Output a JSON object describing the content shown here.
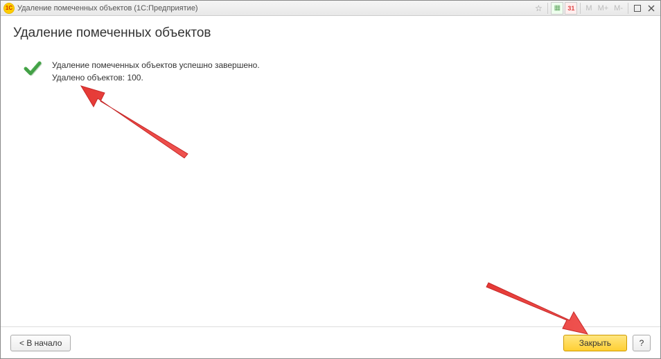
{
  "titlebar": {
    "app_icon_text": "1C",
    "title": "Удаление помеченных объектов  (1С:Предприятие)",
    "mem_buttons": [
      "M",
      "M+",
      "M-"
    ],
    "calendar_day": "31"
  },
  "page": {
    "title": "Удаление помеченных объектов"
  },
  "result": {
    "line1": "Удаление помеченных объектов успешно завершено.",
    "line2": "Удалено объектов: 100."
  },
  "footer": {
    "back_label": "< В начало",
    "close_label": "Закрыть",
    "help_label": "?"
  }
}
